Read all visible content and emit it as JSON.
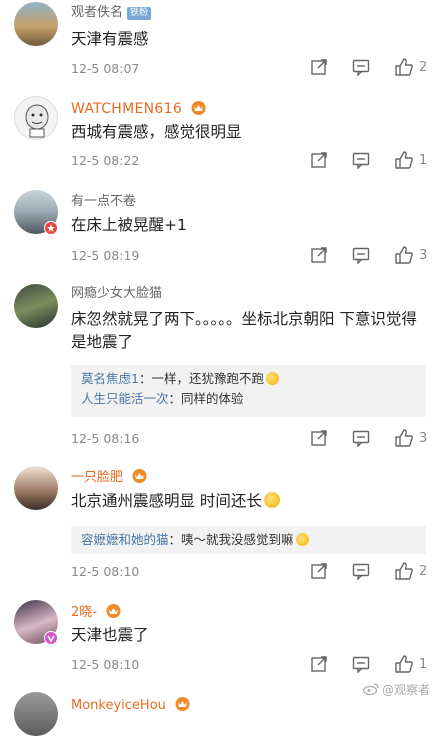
{
  "comments": [
    {
      "name": "观者佚名",
      "name_color": "gray",
      "badge": "铁粉",
      "text": "天津有震感",
      "time": "12-5 08:07",
      "likes": "2"
    },
    {
      "name": "WATCHMEN616",
      "name_color": "orange",
      "text": "西城有震感，感觉很明显",
      "time": "12-5 08:22",
      "likes": "1"
    },
    {
      "name": "有一点不卷",
      "name_color": "gray",
      "text": "在床上被晃醒+1",
      "time": "12-5 08:19",
      "likes": "3"
    },
    {
      "name": "网瘾少女大脸猫",
      "name_color": "gray",
      "text": "床忽然就晃了两下。。。。。坐标北京朝阳 下意识觉得是地震了",
      "time": "12-5 08:16",
      "likes": "3",
      "replies": [
        {
          "name": "莫名焦虑1",
          "text": "一样，还犹豫跑不跑"
        },
        {
          "name": "人生只能活一次",
          "text": "同样的体验"
        }
      ]
    },
    {
      "name": "一只脸肥",
      "name_color": "orange",
      "text": "北京通州震感明显 时间还长",
      "time": "12-5 08:10",
      "likes": "2",
      "replies": [
        {
          "name": "容嬷嬷和她的猫",
          "text": "咦～就我没感觉到嘛"
        }
      ]
    },
    {
      "name": "2晓-",
      "name_color": "orange",
      "text": "天津也震了",
      "time": "12-5 08:10",
      "likes": "1"
    },
    {
      "name": "MonkeyiceHou",
      "name_color": "orange",
      "text": "",
      "time": "",
      "likes": ""
    }
  ],
  "watermark": "@观察者",
  "colors": {
    "orange": "#e86b1f",
    "gray": "#666666",
    "reply_name": "#4a76a8",
    "reply_bg": "#f2f2f2"
  }
}
